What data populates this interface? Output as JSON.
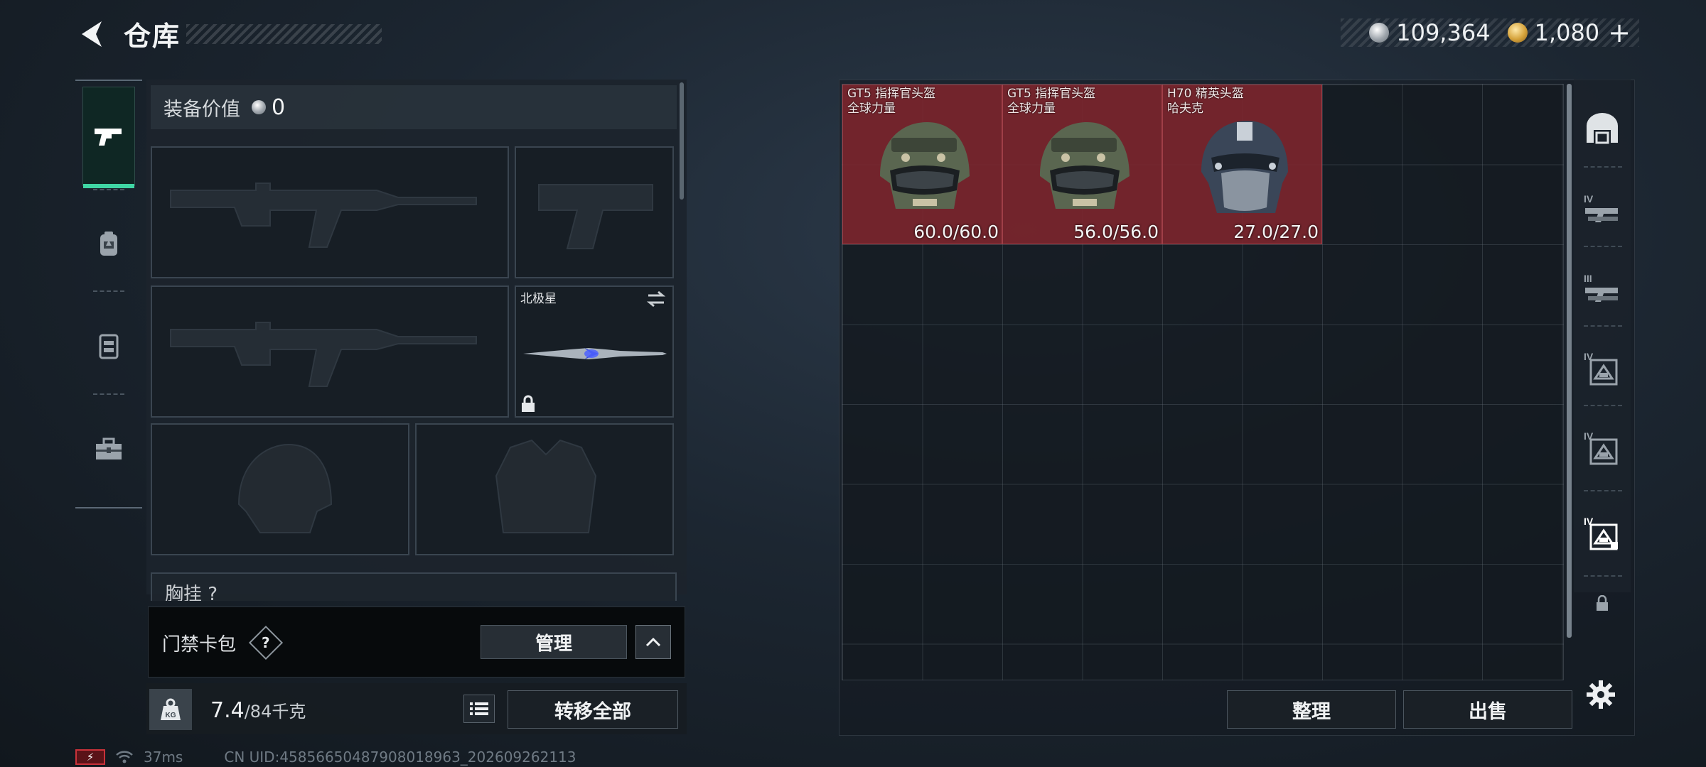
{
  "header": {
    "title": "仓库",
    "currency_silver": "109,364",
    "currency_gold": "1,080",
    "add_label": "+"
  },
  "loadout": {
    "value_label": "装备价值",
    "value": "0",
    "melee_name": "北极星",
    "chest_rig_label": "胸挂 ?"
  },
  "access_card": {
    "label": "门禁卡包",
    "help": "?",
    "manage_label": "管理"
  },
  "capacity": {
    "weight_current": "7.4",
    "weight_max": "/84千克",
    "weight_badge": "KG",
    "transfer_all_label": "转移全部"
  },
  "storage": {
    "items": [
      {
        "name_line1": "GT5 指挥官头盔",
        "name_line2": "全球力量",
        "durability": "60.0/60.0"
      },
      {
        "name_line1": "GT5 指挥官头盔",
        "name_line2": "全球力量",
        "durability": "56.0/56.0"
      },
      {
        "name_line1": "H70 精英头盔",
        "name_line2": "哈夫克",
        "durability": "27.0/27.0"
      }
    ],
    "arrange_label": "整理",
    "sell_label": "出售"
  },
  "right_tabs": [
    {
      "icon": "storage-icon",
      "tier": ""
    },
    {
      "icon": "weapon-case-icon",
      "tier": "IV"
    },
    {
      "icon": "weapon-case-icon",
      "tier": "III"
    },
    {
      "icon": "box-icon",
      "tier": "IV"
    },
    {
      "icon": "box-icon",
      "tier": "IV"
    },
    {
      "icon": "box-icon",
      "tier": "IV"
    }
  ],
  "status": {
    "battery": "⚡",
    "ping": "37ms",
    "uid": "CN UID:4585665048790801896​3_202609262113"
  },
  "colors": {
    "accent": "#3fd6a4",
    "item_bg": "#7c262e",
    "battery_red": "#c8323a"
  }
}
